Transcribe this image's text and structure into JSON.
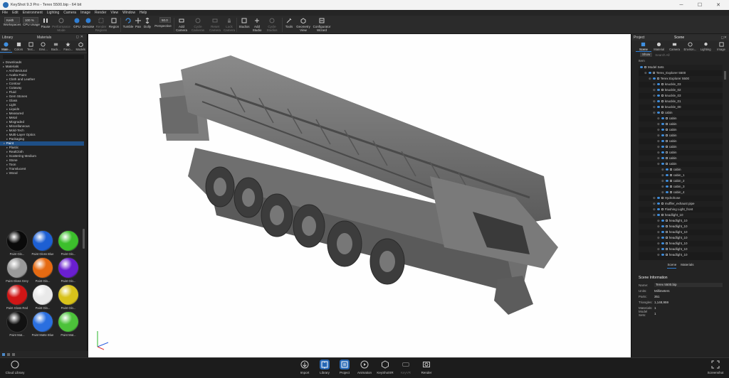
{
  "window": {
    "title": "KeyShot 9.3 Pro - Terex 5500.bip - 64 bit",
    "controls": [
      "─",
      "☐",
      "✕"
    ]
  },
  "menu": [
    "File",
    "Edit",
    "Environment",
    "Lighting",
    "Camera",
    "Image",
    "Render",
    "View",
    "Window",
    "Help"
  ],
  "toolbar": {
    "workspace_value": "Keith",
    "cpu_value": "100 %",
    "workspaces_label": "Workspaces",
    "cpu_label": "CPU Usage",
    "pause_label": "Pause",
    "performance_label": "Performance Mode",
    "gpu_label": "GPU",
    "denoise_label": "Denoise",
    "render_regions_label": "Render Regions",
    "region_label": "Region",
    "tumble_label": "Tumble",
    "pan_label": "Pan",
    "dolly_label": "Dolly",
    "fov_value": "50.0",
    "perspective_label": "Perspective",
    "add_camera_label": "Add Camera",
    "cycle_cameras_label": "Cycle Cameras",
    "reset_camera_label": "Reset Camera",
    "lock_camera_label": "Lock Camera",
    "studios_label": "Studios",
    "add_studio_label": "Add Studio",
    "cycle_studios_label": "Cycle Studios",
    "tools_label": "Tools",
    "geometry_view_label": "Geometry View",
    "configurator_label": "Configurator Wizard"
  },
  "library": {
    "panel_title": "Library",
    "section_title": "Materials",
    "tabs": [
      "Mate...",
      "Colors",
      "Text...",
      "Envi...",
      "Back...",
      "Favo...",
      "Models"
    ],
    "tree": [
      "Downloads",
      "Materials",
      "Architectural",
      "Axalta Paint",
      "Cloth and Leather",
      "Contour",
      "Cutaway",
      "Fluid",
      "Gem Stones",
      "Glass",
      "Light",
      "Liquids",
      "Measured",
      "Metal",
      "Mixgraded",
      "Miscellaneous",
      "Mold-Tech",
      "Multi-Layer Optics",
      "Packaging",
      "Paint",
      "Plastic",
      "RealCloth",
      "Scattering Medium",
      "Stone",
      "Toon",
      "Translucent",
      "Wood"
    ],
    "selected_index": 19,
    "swatches": [
      {
        "label": "Paint Glo...",
        "color": "#0a0a0a"
      },
      {
        "label": "Paint Gloss Blue",
        "color": "#1d5fd3"
      },
      {
        "label": "Paint Glo...",
        "color": "#3cbf2c"
      },
      {
        "label": "Paint Gloss Grey",
        "color": "#9a9a9a"
      },
      {
        "label": "Paint Glo...",
        "color": "#e56a12"
      },
      {
        "label": "Paint Glo...",
        "color": "#6a1fd0"
      },
      {
        "label": "Paint Gloss Red",
        "color": "#d01616"
      },
      {
        "label": "Paint Glo...",
        "color": "#e9e9e9"
      },
      {
        "label": "Paint Glo...",
        "color": "#d8c21b"
      },
      {
        "label": "Paint Mat...",
        "color": "#121212"
      },
      {
        "label": "Paint Matte Blue",
        "color": "#2a6fe0"
      },
      {
        "label": "Paint Mat...",
        "color": "#4cc23a"
      }
    ]
  },
  "scene": {
    "project_label": "Project",
    "title": "Scene",
    "tabs": [
      "Scene",
      "Material",
      "Camera",
      "Environ...",
      "Lighting",
      "Image"
    ],
    "show_label": "Show",
    "search_placeholder": "Search All",
    "item_header": "Item",
    "tree": [
      {
        "label": "Model Sets",
        "indent": 0
      },
      {
        "label": "Terex_Explorer 5500",
        "indent": 1
      },
      {
        "label": "Terex Explorer 5500",
        "indent": 2
      },
      {
        "label": "knuckle_03",
        "indent": 3
      },
      {
        "label": "knuckle_02",
        "indent": 3
      },
      {
        "label": "knuckle_03",
        "indent": 3
      },
      {
        "label": "knuckle_01",
        "indent": 3
      },
      {
        "label": "knuckle_00",
        "indent": 3
      },
      {
        "label": "cabin",
        "indent": 3
      },
      {
        "label": "cabin",
        "indent": 4
      },
      {
        "label": "cabin",
        "indent": 4
      },
      {
        "label": "cabin",
        "indent": 4
      },
      {
        "label": "cabin",
        "indent": 4
      },
      {
        "label": "cabin",
        "indent": 4
      },
      {
        "label": "cabin",
        "indent": 4
      },
      {
        "label": "cabin",
        "indent": 4
      },
      {
        "label": "cabin",
        "indent": 4
      },
      {
        "label": "cabin",
        "indent": 4
      },
      {
        "label": "cabin",
        "indent": 5
      },
      {
        "label": "cabin_1",
        "indent": 5
      },
      {
        "label": "cabin_2",
        "indent": 5
      },
      {
        "label": "cabin_3",
        "indent": 5
      },
      {
        "label": "cabin_4",
        "indent": 5
      },
      {
        "label": "Hydrohose",
        "indent": 3
      },
      {
        "label": "muffler_exhaust pipe",
        "indent": 3
      },
      {
        "label": "Flashing Light_front",
        "indent": 3
      },
      {
        "label": "headlight_10",
        "indent": 3
      },
      {
        "label": "headlight_10",
        "indent": 4
      },
      {
        "label": "headlight_10",
        "indent": 4
      },
      {
        "label": "headlight_10",
        "indent": 4
      },
      {
        "label": "headlight_10",
        "indent": 4
      },
      {
        "label": "headlight_10",
        "indent": 4
      },
      {
        "label": "headlight_10",
        "indent": 4
      },
      {
        "label": "headlight_10",
        "indent": 4
      }
    ],
    "subtabs": [
      "Scene",
      "Materials"
    ],
    "info_title": "Scene Information",
    "info": [
      {
        "key": "Name:",
        "value": "Terex 5500.bip",
        "box": true
      },
      {
        "key": "Units:",
        "value": "Millimeters",
        "box": false
      },
      {
        "key": "Parts:",
        "value": "351",
        "box": false
      },
      {
        "key": "Triangles:",
        "value": "1,148,959",
        "box": false
      },
      {
        "key": "Materials:",
        "value": "1",
        "box": false
      },
      {
        "key": "Model Sets:",
        "value": "1",
        "box": false
      }
    ]
  },
  "dock": {
    "cloud_library": "Cloud Library",
    "import": "Import",
    "library": "Library",
    "project": "Project",
    "animation": "Animation",
    "keyshotxr": "KeyShotXR",
    "keyvr": "KeyVR",
    "render": "Render",
    "screenshot": "Screenshot"
  }
}
